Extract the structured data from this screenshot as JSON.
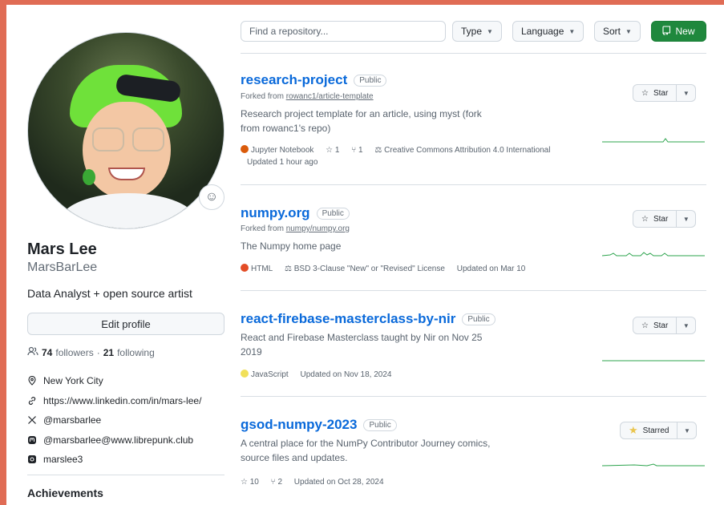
{
  "profile": {
    "name": "Mars Lee",
    "username": "MarsBarLee",
    "bio": "Data Analyst + open source artist",
    "edit_label": "Edit profile",
    "followers_count": "74",
    "followers_label": "followers",
    "separator": "·",
    "following_count": "21",
    "following_label": "following",
    "details": [
      {
        "icon": "location-icon",
        "text": "New York City"
      },
      {
        "icon": "link-icon",
        "text": "https://www.linkedin.com/in/mars-lee/"
      },
      {
        "icon": "x-twitter-icon",
        "text": "@marsbarlee"
      },
      {
        "icon": "mastodon-icon",
        "text": "@marsbarlee@www.librepunk.club"
      },
      {
        "icon": "instagram-icon",
        "text": "marslee3"
      }
    ],
    "achievements_label": "Achievements"
  },
  "toolbar": {
    "search_placeholder": "Find a repository...",
    "type_label": "Type",
    "language_label": "Language",
    "sort_label": "Sort",
    "new_label": "New"
  },
  "repos": [
    {
      "name": "research-project",
      "visibility": "Public",
      "forked_prefix": "Forked from",
      "forked_from": "rowanc1/article-template",
      "description": "Research project template for an article, using myst (fork from rowanc1's repo)",
      "language": "Jupyter Notebook",
      "language_color": "#DA5B0B",
      "stars": "1",
      "forks": "1",
      "license": "Creative Commons Attribution 4.0 International",
      "updated": "Updated 1 hour ago",
      "star_label": "Star",
      "starred": false
    },
    {
      "name": "numpy.org",
      "visibility": "Public",
      "forked_prefix": "Forked from",
      "forked_from": "numpy/numpy.org",
      "description": "The Numpy home page",
      "language": "HTML",
      "language_color": "#e34c26",
      "license": "BSD 3-Clause \"New\" or \"Revised\" License",
      "updated": "Updated on Mar 10",
      "star_label": "Star",
      "starred": false
    },
    {
      "name": "react-firebase-masterclass-by-nir",
      "visibility": "Public",
      "description": "React and Firebase Masterclass taught by Nir on Nov 25 2019",
      "language": "JavaScript",
      "language_color": "#f1e05a",
      "updated": "Updated on Nov 18, 2024",
      "star_label": "Star",
      "starred": false
    },
    {
      "name": "gsod-numpy-2023",
      "visibility": "Public",
      "description": "A central place for the NumPy Contributor Journey comics, source files and updates.",
      "stars": "10",
      "forks": "2",
      "updated": "Updated on Oct 28, 2024",
      "star_label": "Starred",
      "starred": true
    }
  ],
  "colors": {
    "link": "#0969da",
    "new_button": "#1f883d",
    "sparkline": "#2da44e",
    "frame_border": "#e06c55",
    "starred_icon": "#eac54f"
  }
}
